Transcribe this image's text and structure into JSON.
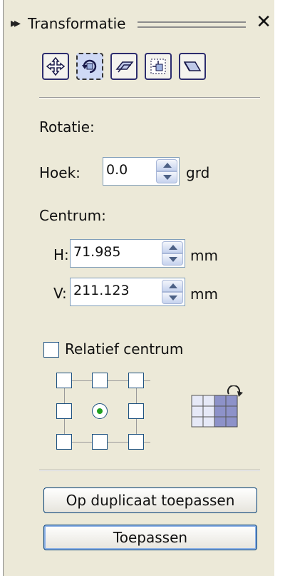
{
  "panel": {
    "title": "Transformatie",
    "toolbar": [
      "move-tool-icon",
      "rotate-tool-icon",
      "scale-tool-icon",
      "size-tool-icon",
      "skew-tool-icon"
    ],
    "rotation_section": "Rotatie:",
    "angle_label": "Hoek:",
    "angle_value": "0.0",
    "angle_unit": "grd",
    "center_section": "Centrum:",
    "h_label": "H:",
    "h_value": "71.985",
    "h_unit": "mm",
    "v_label": "V:",
    "v_value": "211.123",
    "v_unit": "mm",
    "relative_center_label": "Relatief centrum",
    "relative_center_checked": false,
    "anchor_selected": "center",
    "apply_duplicate_button": "Op duplicaat toepassen",
    "apply_button": "Toepassen"
  }
}
